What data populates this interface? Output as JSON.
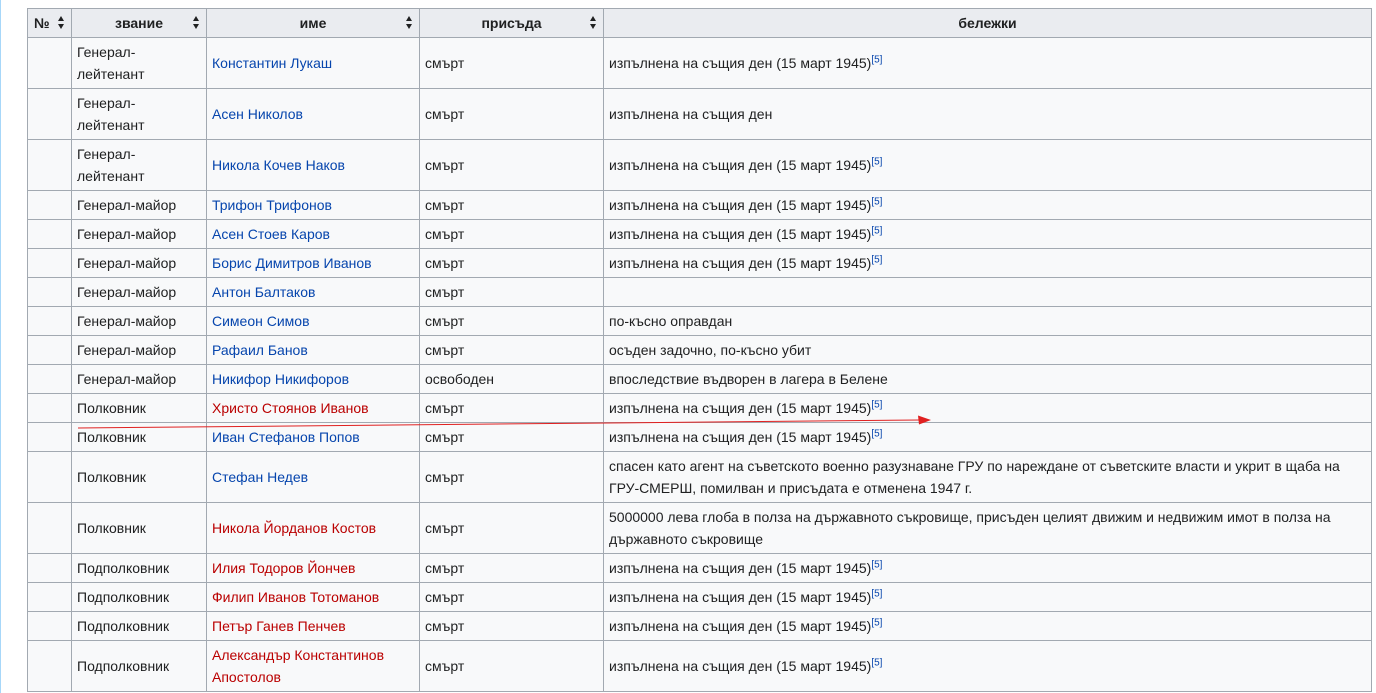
{
  "table": {
    "headers": {
      "num": "№",
      "rank": "звание",
      "name": "име",
      "sentence": "присъда",
      "notes": "бележки"
    },
    "rows": [
      {
        "rank": "Генерал-лейтенант",
        "name": "Константин Лукаш",
        "red": false,
        "sentence": "смърт",
        "note": "изпълнена на същия ден (15 март 1945)",
        "ref": "[5]",
        "tall": true
      },
      {
        "rank": "Генерал-лейтенант",
        "name": "Асен Николов",
        "red": false,
        "sentence": "смърт",
        "note": "изпълнена на същия ден",
        "ref": "",
        "tall": true
      },
      {
        "rank": "Генерал-лейтенант",
        "name": "Никола Кочев Наков",
        "red": false,
        "sentence": "смърт",
        "note": "изпълнена на същия ден (15 март 1945)",
        "ref": "[5]",
        "tall": true
      },
      {
        "rank": "Генерал-майор",
        "name": "Трифон Трифонов",
        "red": false,
        "sentence": "смърт",
        "note": "изпълнена на същия ден (15 март 1945)",
        "ref": "[5]",
        "tall": false
      },
      {
        "rank": "Генерал-майор",
        "name": "Асен Стоев Каров",
        "red": false,
        "sentence": "смърт",
        "note": "изпълнена на същия ден (15 март 1945)",
        "ref": "[5]",
        "tall": false
      },
      {
        "rank": "Генерал-майор",
        "name": "Борис Димитров Иванов",
        "red": false,
        "sentence": "смърт",
        "note": "изпълнена на същия ден (15 март 1945)",
        "ref": "[5]",
        "tall": false
      },
      {
        "rank": "Генерал-майор",
        "name": "Антон Балтаков",
        "red": false,
        "sentence": "смърт",
        "note": "",
        "ref": "",
        "tall": false
      },
      {
        "rank": "Генерал-майор",
        "name": "Симеон Симов",
        "red": false,
        "sentence": "смърт",
        "note": "по-късно оправдан",
        "ref": "",
        "tall": false
      },
      {
        "rank": "Генерал-майор",
        "name": "Рафаил Банов",
        "red": false,
        "sentence": "смърт",
        "note": "осъден задочно, по-късно убит",
        "ref": "",
        "tall": false
      },
      {
        "rank": "Генерал-майор",
        "name": "Никифор Никифоров",
        "red": false,
        "sentence": "освободен",
        "note": "впоследствие въдворен в лагера в Белене",
        "ref": "",
        "tall": false
      },
      {
        "rank": "Полковник",
        "name": "Христо Стоянов Иванов",
        "red": true,
        "sentence": "смърт",
        "note": "изпълнена на същия ден (15 март 1945)",
        "ref": "[5]",
        "tall": false
      },
      {
        "rank": "Полковник",
        "name": "Иван Стефанов Попов",
        "red": false,
        "sentence": "смърт",
        "note": "изпълнена на същия ден (15 март 1945)",
        "ref": "[5]",
        "tall": false
      },
      {
        "rank": "Полковник",
        "name": "Стефан Недев",
        "red": false,
        "sentence": "смърт",
        "note": "спасен като агент на съветското военно разузнаване ГРУ по нареждане от съветските власти и укрит в щаба на ГРУ-СМЕРШ, помилван и присъдата е отменена 1947 г.",
        "ref": "",
        "tall": true
      },
      {
        "rank": "Полковник",
        "name": "Никола Йорданов Костов",
        "red": true,
        "sentence": "смърт",
        "note": "5000000 лева глоба в полза на държавното съкровище, присъден целият движим и недвижим имот в полза на държавното съкровище",
        "ref": "",
        "tall": true
      },
      {
        "rank": "Подполковник",
        "name": "Илия Тодоров Йончев",
        "red": true,
        "sentence": "смърт",
        "note": "изпълнена на същия ден (15 март 1945)",
        "ref": "[5]",
        "tall": false
      },
      {
        "rank": "Подполковник",
        "name": "Филип Иванов Тотоманов",
        "red": true,
        "sentence": "смърт",
        "note": "изпълнена на същия ден (15 март 1945)",
        "ref": "[5]",
        "tall": false
      },
      {
        "rank": "Подполковник",
        "name": "Петър Ганев Пенчев",
        "red": true,
        "sentence": "смърт",
        "note": "изпълнена на същия ден (15 март 1945)",
        "ref": "[5]",
        "tall": false
      },
      {
        "rank": "Подполковник",
        "name": "Александър Константинов Апостолов",
        "red": true,
        "sentence": "смърт",
        "note": "изпълнена на същия ден (15 март 1945)",
        "ref": "[5]",
        "tall": true
      }
    ]
  },
  "colors": {
    "link": "#0645ad",
    "redlink": "#ba0000",
    "annotation_arrow": "#e02020"
  }
}
